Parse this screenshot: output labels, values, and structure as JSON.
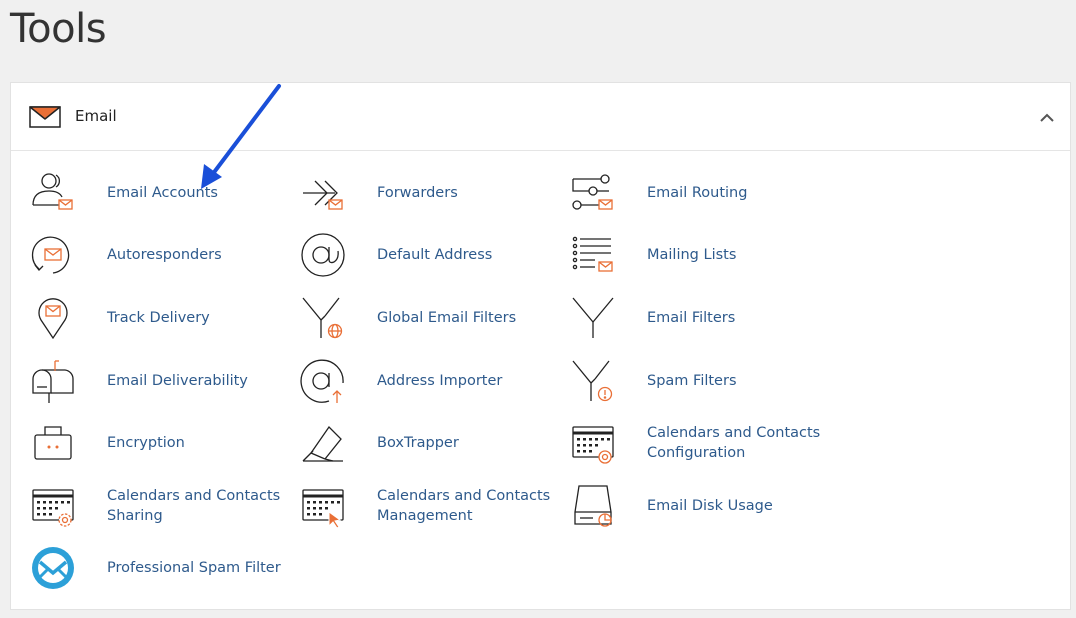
{
  "page": {
    "title": "Tools"
  },
  "section": {
    "title": "Email",
    "collapse_icon": "chevron-up-icon"
  },
  "colors": {
    "link": "#2e5a8c",
    "icon_accent": "#e96f36",
    "annotation_arrow": "#1a4fd8"
  },
  "items": [
    {
      "label": "Email Accounts",
      "icon": "email-accounts-icon"
    },
    {
      "label": "Forwarders",
      "icon": "forwarders-icon"
    },
    {
      "label": "Email Routing",
      "icon": "email-routing-icon"
    },
    {
      "label": "Autoresponders",
      "icon": "autoresponders-icon"
    },
    {
      "label": "Default Address",
      "icon": "default-address-icon"
    },
    {
      "label": "Mailing Lists",
      "icon": "mailing-lists-icon"
    },
    {
      "label": "Track Delivery",
      "icon": "track-delivery-icon"
    },
    {
      "label": "Global Email Filters",
      "icon": "global-email-filters-icon"
    },
    {
      "label": "Email Filters",
      "icon": "email-filters-icon"
    },
    {
      "label": "Email Deliverability",
      "icon": "email-deliverability-icon"
    },
    {
      "label": "Address Importer",
      "icon": "address-importer-icon"
    },
    {
      "label": "Spam Filters",
      "icon": "spam-filters-icon"
    },
    {
      "label": "Encryption",
      "icon": "encryption-icon"
    },
    {
      "label": "BoxTrapper",
      "icon": "boxtrapper-icon"
    },
    {
      "label": "Calendars and Contacts Configuration",
      "icon": "calendars-contacts-configuration-icon"
    },
    {
      "label": "Calendars and Contacts Sharing",
      "icon": "calendars-contacts-sharing-icon"
    },
    {
      "label": "Calendars and Contacts Management",
      "icon": "calendars-contacts-management-icon"
    },
    {
      "label": "Email Disk Usage",
      "icon": "email-disk-usage-icon"
    },
    {
      "label": "Professional Spam Filter",
      "icon": "professional-spam-filter-icon"
    }
  ]
}
